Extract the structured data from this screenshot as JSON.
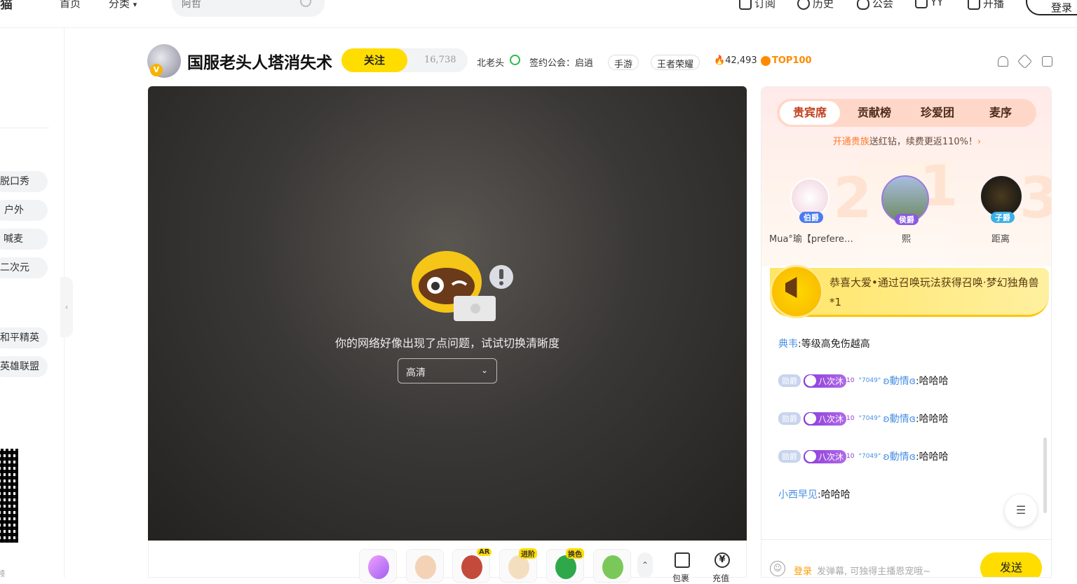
{
  "topbar": {
    "logo_glyph": "猫",
    "home": "首页",
    "category": "分类",
    "search_placeholder": "阿哲",
    "right_nav": [
      "订阅",
      "历史",
      "公会",
      "YY",
      "开播"
    ],
    "login": "登录"
  },
  "sidebar": {
    "categories": [
      "脱口秀",
      "户外",
      "喊麦",
      "二次元"
    ],
    "games": [
      "和平精英",
      "英雄联盟"
    ],
    "qr_caption": "领"
  },
  "room": {
    "title": "国服老头人塔消失术",
    "follow_label": "关注",
    "follow_count": "16,738",
    "anchor": "北老头",
    "guild": "签约公会：启逍",
    "tags": [
      "手游",
      "王者荣耀"
    ],
    "heat": "42,493",
    "rank_badge": "TOP100"
  },
  "player": {
    "error_message": "你的网络好像出现了点问题，试试切换清晰度",
    "quality": "高清"
  },
  "giftbar": {
    "badges": [
      "AR",
      "进阶",
      "换色"
    ],
    "package_label": "包裹",
    "recharge_label": "充值"
  },
  "panel": {
    "tabs": [
      "贵宾席",
      "贡献榜",
      "珍爱团",
      "麦序"
    ],
    "promo_highlight": "开通贵族",
    "promo_text": "送红钻，续费更返110%！",
    "ranks": [
      {
        "rank": "2",
        "name": "Mua°瑜【prefere…",
        "badge": "伯爵"
      },
      {
        "rank": "1",
        "name": "熙",
        "badge": "侯爵"
      },
      {
        "rank": "3",
        "name": "距离",
        "badge": "子爵"
      }
    ],
    "announcement": "恭喜大爱•通过召唤玩法获得召唤·梦幻独角兽*1",
    "chat": [
      {
        "user": "典韦",
        "text": ":等级高免伤越高"
      },
      {
        "badge": "勋爵",
        "fan": "八次沐",
        "level": "10",
        "sup": "°7049°",
        "user": "ʚ動情ɞ",
        "text": ":哈哈哈"
      },
      {
        "badge": "勋爵",
        "fan": "八次沐",
        "level": "10",
        "sup": "°7049°",
        "user": "ʚ動情ɞ",
        "text": ":哈哈哈"
      },
      {
        "badge": "勋爵",
        "fan": "八次沐",
        "level": "10",
        "sup": "°7049°",
        "user": "ʚ動情ɞ",
        "text": ":哈哈哈"
      },
      {
        "user": "小西早见",
        "text": ":哈哈哈"
      }
    ],
    "input_login": "登录",
    "input_placeholder": "发弹幕, 可独得主播恩宠哦~",
    "send": "发送"
  },
  "colors": {
    "accent": "#ffdd00",
    "link": "#4a90e2",
    "promo": "#ff7a2a"
  }
}
